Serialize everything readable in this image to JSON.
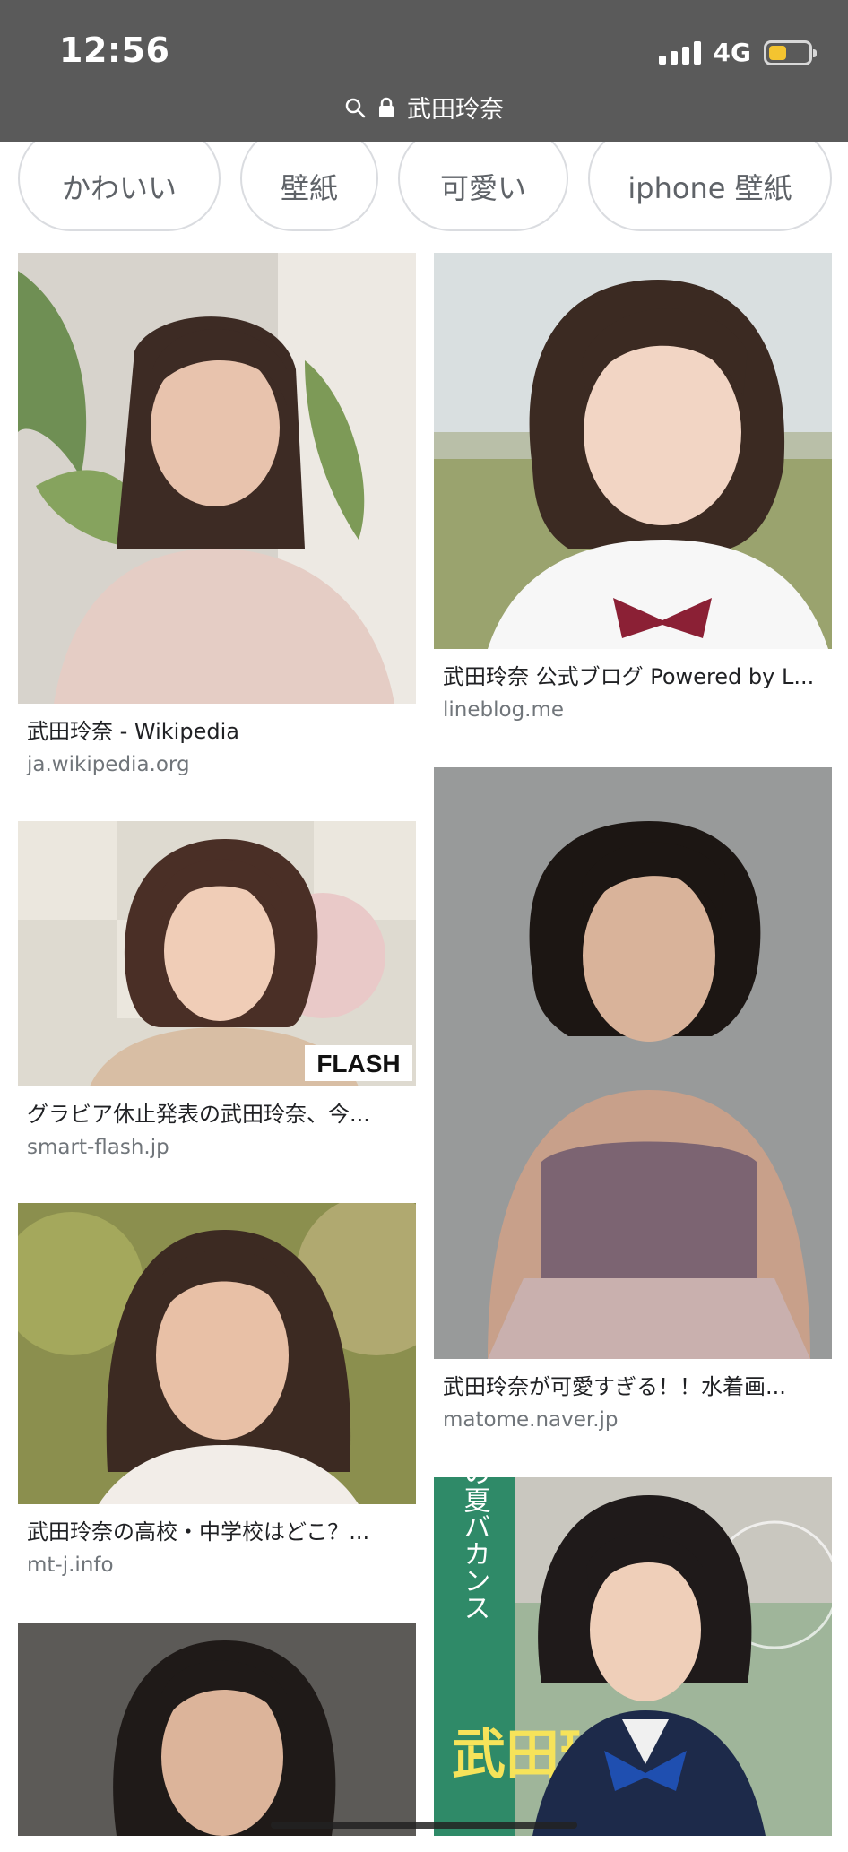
{
  "status_bar": {
    "time": "12:56",
    "network": "4G",
    "battery_level": 0.45
  },
  "address_bar": {
    "query": "武田玲奈"
  },
  "chips": [
    {
      "label": "かわいい"
    },
    {
      "label": "壁紙"
    },
    {
      "label": "可愛い"
    },
    {
      "label": "iphone 壁紙"
    }
  ],
  "results": [
    {
      "title": "武田玲奈 - Wikipedia",
      "source": "ja.wikipedia.org"
    },
    {
      "title": "武田玲奈 公式ブログ Powered by L...",
      "source": "lineblog.me"
    },
    {
      "title": "グラビア休止発表の武田玲奈、今...",
      "source": "smart-flash.jp"
    },
    {
      "title": "武田玲奈が可愛すぎる！！水着画...",
      "source": "matome.naver.jp"
    },
    {
      "title": "武田玲奈の高校・中学校はどこ？...",
      "source": "mt-j.info"
    },
    {
      "title": "",
      "source": ""
    },
    {
      "title": "",
      "source": ""
    }
  ],
  "image_text": {
    "flash_logo": "FLASH",
    "magazine_headline": "玲奈の夏バカンス",
    "magazine_name": "武田玲"
  },
  "colors": {
    "header_bg": "#5a5a5a",
    "chip_border": "#dadce0",
    "source_text": "#70757a",
    "battery": "#f4c430"
  }
}
